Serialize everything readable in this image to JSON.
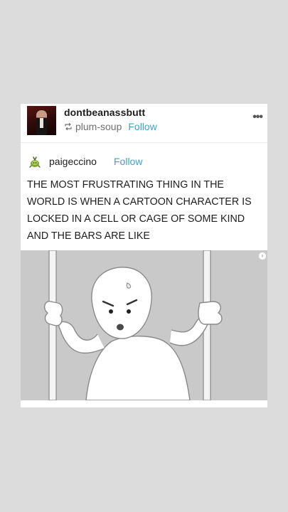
{
  "reblogger": {
    "name": "dontbeanassbutt",
    "reblogged_from": "plum-soup",
    "follow_label": "Follow"
  },
  "menu": {
    "more_label": "•••"
  },
  "original_poster": {
    "name": "paigeccino",
    "follow_label": "Follow"
  },
  "post": {
    "text": "THE MOST FRUSTRATING THING IN THE\nWORLD IS WHEN A CARTOON CHARACTER IS\nLOCKED IN A CELL OR CAGE OF SOME KIND\nAND THE BARS ARE LIKE"
  },
  "image_nav": {
    "icon": "chevron-right-icon",
    "glyph": "›"
  },
  "colors": {
    "page_background": "#dcdcdc",
    "card_background": "#ffffff",
    "link_accent": "#3ba4c9",
    "comic_background": "#c9c9c9"
  }
}
